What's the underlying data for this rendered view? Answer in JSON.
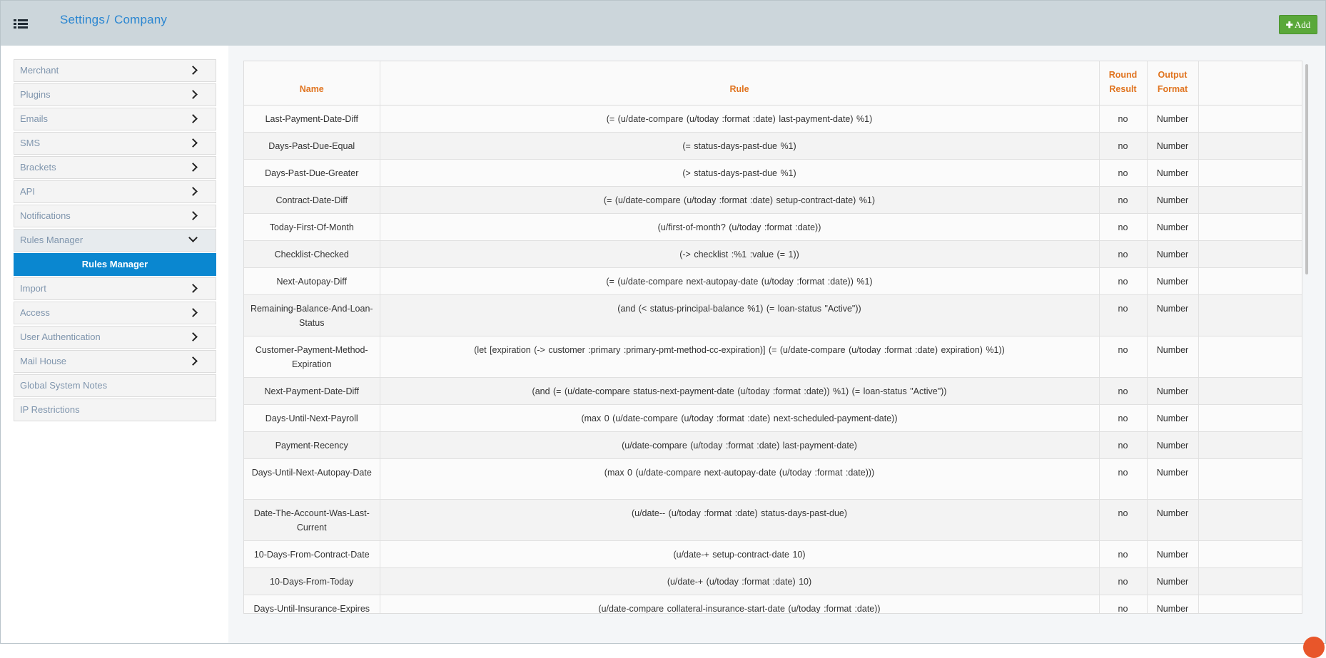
{
  "header": {
    "breadcrumb": [
      "Settings",
      "Company"
    ],
    "separator": "/",
    "add_button": "Add",
    "add_icon": "plus-icon",
    "menu_icon": "list-icon"
  },
  "sidebar": {
    "items": [
      {
        "label": "Merchant",
        "chevron": "right"
      },
      {
        "label": "Plugins",
        "chevron": "right"
      },
      {
        "label": "Emails",
        "chevron": "right"
      },
      {
        "label": "SMS",
        "chevron": "right"
      },
      {
        "label": "Brackets",
        "chevron": "right"
      },
      {
        "label": "API",
        "chevron": "right"
      },
      {
        "label": "Notifications",
        "chevron": "right"
      },
      {
        "label": "Rules Manager",
        "chevron": "down"
      },
      {
        "label": "Import",
        "chevron": "right"
      },
      {
        "label": "Access",
        "chevron": "right"
      },
      {
        "label": "User Authentication",
        "chevron": "right"
      },
      {
        "label": "Mail House",
        "chevron": "right"
      },
      {
        "label": "Global System Notes",
        "chevron": ""
      },
      {
        "label": "IP Restrictions",
        "chevron": ""
      }
    ],
    "active_sub_item": "Rules Manager"
  },
  "table": {
    "headers": {
      "name": "Name",
      "rule": "Rule",
      "round_result": [
        "Round",
        "Result"
      ],
      "output_format": [
        "Output",
        "Format"
      ]
    },
    "rows": [
      {
        "name": "Last-Payment-Date-Diff",
        "rule": "(= (u/date-compare (u/today :format :date) last-payment-date) %1)",
        "round": "no",
        "format": "Number"
      },
      {
        "name": "Days-Past-Due-Equal",
        "rule": "(= status-days-past-due %1)",
        "round": "no",
        "format": "Number"
      },
      {
        "name": "Days-Past-Due-Greater",
        "rule": "(> status-days-past-due %1)",
        "round": "no",
        "format": "Number"
      },
      {
        "name": "Contract-Date-Diff",
        "rule": "(= (u/date-compare (u/today :format :date) setup-contract-date) %1)",
        "round": "no",
        "format": "Number"
      },
      {
        "name": "Today-First-Of-Month",
        "rule": "(u/first-of-month? (u/today :format :date))",
        "round": "no",
        "format": "Number"
      },
      {
        "name": "Checklist-Checked",
        "rule": "(-> checklist :%1 :value (= 1))",
        "round": "no",
        "format": "Number"
      },
      {
        "name": "Next-Autopay-Diff",
        "rule": "(= (u/date-compare next-autopay-date (u/today :format :date)) %1)",
        "round": "no",
        "format": "Number"
      },
      {
        "name": "Remaining-Balance-And-Loan-Status",
        "rule": "(and (< status-principal-balance %1) (= loan-status \"Active\"))",
        "round": "no",
        "format": "Number"
      },
      {
        "name": "Customer-Payment-Method-Expiration",
        "rule": "(let [expiration (-> customer :primary :primary-pmt-method-cc-expiration)] (= (u/date-compare (u/today :format :date) expiration) %1))",
        "round": "no",
        "format": "Number"
      },
      {
        "name": "Next-Payment-Date-Diff",
        "rule": "(and (= (u/date-compare status-next-payment-date (u/today :format :date)) %1) (= loan-status \"Active\"))",
        "round": "no",
        "format": "Number"
      },
      {
        "name": "Days-Until-Next-Payroll",
        "rule": "(max 0 (u/date-compare (u/today :format :date) next-scheduled-payment-date))",
        "round": "no",
        "format": "Number"
      },
      {
        "name": "Payment-Recency",
        "rule": "(u/date-compare (u/today :format :date) last-payment-date)",
        "round": "no",
        "format": "Number"
      },
      {
        "name": "Days-Until-Next-Autopay-Date",
        "rule": "(max 0 (u/date-compare next-autopay-date (u/today :format :date)))",
        "round": "no",
        "format": "Number"
      },
      {
        "name": "Date-The-Account-Was-Last-Current",
        "rule": "(u/date-- (u/today :format :date) status-days-past-due)",
        "round": "no",
        "format": "Number"
      },
      {
        "name": "10-Days-From-Contract-Date",
        "rule": "(u/date-+ setup-contract-date 10)",
        "round": "no",
        "format": "Number"
      },
      {
        "name": "10-Days-From-Today",
        "rule": "(u/date-+ (u/today :format :date) 10)",
        "round": "no",
        "format": "Number"
      },
      {
        "name": "Days-Until-Insurance-Expires",
        "rule": "(u/date-compare collateral-insurance-start-date (u/today :format :date))",
        "round": "no",
        "format": "Number"
      },
      {
        "name": "",
        "rule": "",
        "round": "",
        "format": ""
      }
    ]
  },
  "colors": {
    "header_bg": "#ccd6db",
    "breadcrumb": "#2a86d1",
    "add_button": "#5aa83a",
    "active_sub_item": "#0a87d0",
    "column_header": "#e07420"
  }
}
